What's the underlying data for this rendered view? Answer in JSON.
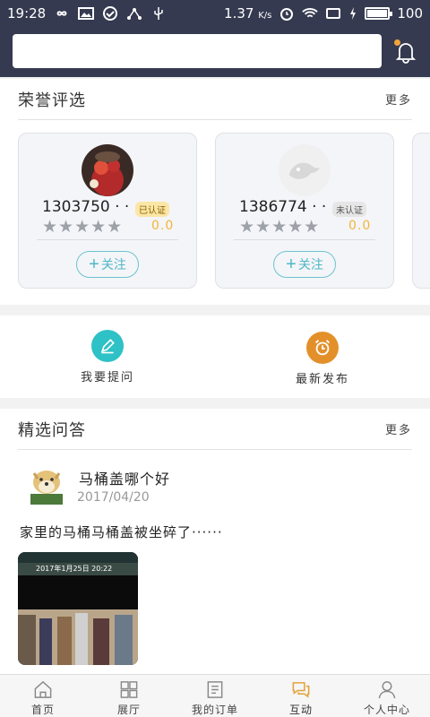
{
  "status_bar": {
    "time": "19:28",
    "speed": "1.37",
    "speed_unit": "K/s",
    "battery": "100",
    "battery_level": 1.0
  },
  "search": {
    "placeholder": ""
  },
  "honor": {
    "title": "荣誉评选",
    "more": "更多",
    "cards": [
      {
        "name": "1303750 · ·",
        "badge": "已认证",
        "stars": "★★★★★",
        "score": "0.0",
        "follow": "关注",
        "rating": 0
      },
      {
        "name": "1386774 · ·",
        "badge": "未认证",
        "stars": "★★★★★",
        "score": "0.0",
        "follow": "关注",
        "rating": 0
      }
    ]
  },
  "actions": [
    {
      "label": "我要提问",
      "icon": "pencil-icon",
      "color": "#2ec1c6"
    },
    {
      "label": "最新发布",
      "icon": "alarm-clock-icon",
      "color": "#e3902b"
    }
  ],
  "qa": {
    "title": "精选问答",
    "more": "更多",
    "item": {
      "title": "马桶盖哪个好",
      "date": "2017/04/20",
      "body": "家里的马桶马桶盖被坐碎了······",
      "thumb_caption": "2017年1月25日 20:22"
    }
  },
  "tabs": [
    {
      "label": "首页",
      "icon": "home-icon"
    },
    {
      "label": "展厅",
      "icon": "gallery-icon"
    },
    {
      "label": "我的订单",
      "icon": "order-icon"
    },
    {
      "label": "互动",
      "icon": "chat-icon",
      "active": true
    },
    {
      "label": "个人中心",
      "icon": "person-icon"
    }
  ],
  "colors": {
    "header": "#353a50",
    "accent": "#e3a23a",
    "follow": "#4fb7c8"
  }
}
